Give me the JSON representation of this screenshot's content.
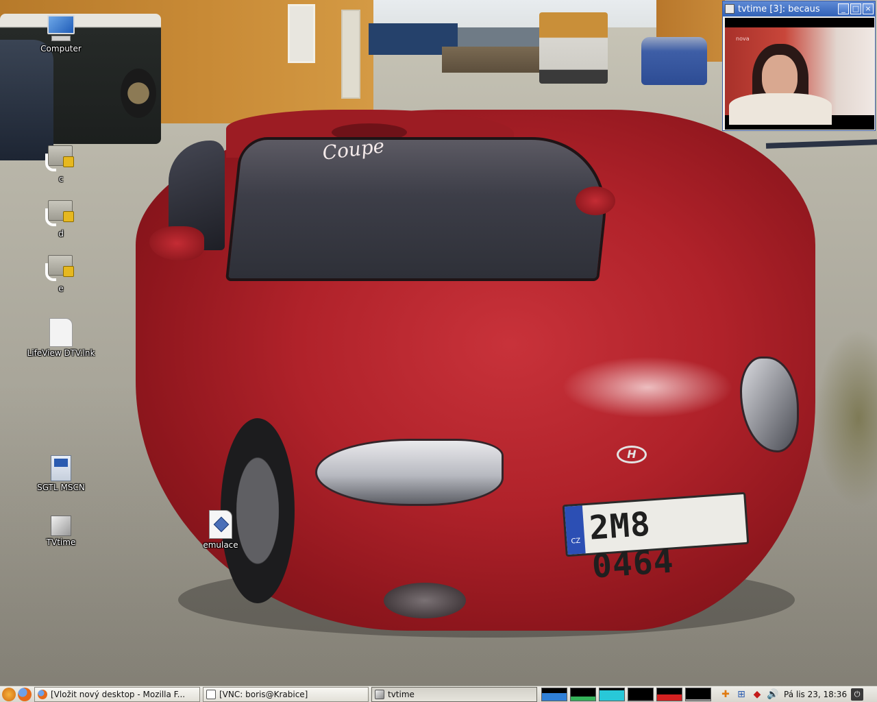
{
  "desktop": {
    "icons": [
      {
        "label": "Computer",
        "icon": "computer-icon"
      },
      {
        "label": "c",
        "icon": "network-drive-icon"
      },
      {
        "label": "d",
        "icon": "network-drive-icon"
      },
      {
        "label": "e",
        "icon": "network-drive-icon"
      },
      {
        "label": "LifeView DTV.lnk",
        "icon": "blank-file-icon"
      },
      {
        "label": "SGTL MSCN",
        "icon": "application-icon"
      },
      {
        "label": "TVtime",
        "icon": "tvtime-icon"
      },
      {
        "label": "emulace",
        "icon": "emulator-file-icon"
      }
    ],
    "wallpaper": {
      "windshield_text": "Coupe",
      "plate_country": "CZ",
      "plate_number": "2M8 0464"
    }
  },
  "tvtime_window": {
    "title": "tvtime [3]: becaus",
    "buttons": {
      "minimize": "_",
      "maximize": "□",
      "close": "×"
    },
    "channel_logo": "nova"
  },
  "taskbar": {
    "tasks": [
      {
        "label": "[Vložit nový desktop - Mozilla F...",
        "icon": "firefox-icon",
        "active": false
      },
      {
        "label": "[VNC: boris@Krabice]",
        "icon": "vnc-window-icon",
        "active": false
      },
      {
        "label": "tvtime",
        "icon": "tvtime-icon",
        "active": true
      }
    ],
    "monitors": [
      {
        "name": "cpu-monitor",
        "color": "#2f7fd6",
        "level": 0.6
      },
      {
        "name": "memory-monitor",
        "color": "#35b35a",
        "level": 0.3
      },
      {
        "name": "network-monitor",
        "color": "#28c8d8",
        "level": 0.8
      },
      {
        "name": "swap-monitor",
        "color": "#3a3a3a",
        "level": 0.05
      },
      {
        "name": "load-monitor",
        "color": "#d42020",
        "level": 0.5
      },
      {
        "name": "disk-monitor",
        "color": "#9a9a9a",
        "level": 0.1
      }
    ],
    "clock": "Pá lis 23, 18:36"
  },
  "colors": {
    "titlebar": "#3161b6",
    "taskbar": "#d9d7cf"
  }
}
